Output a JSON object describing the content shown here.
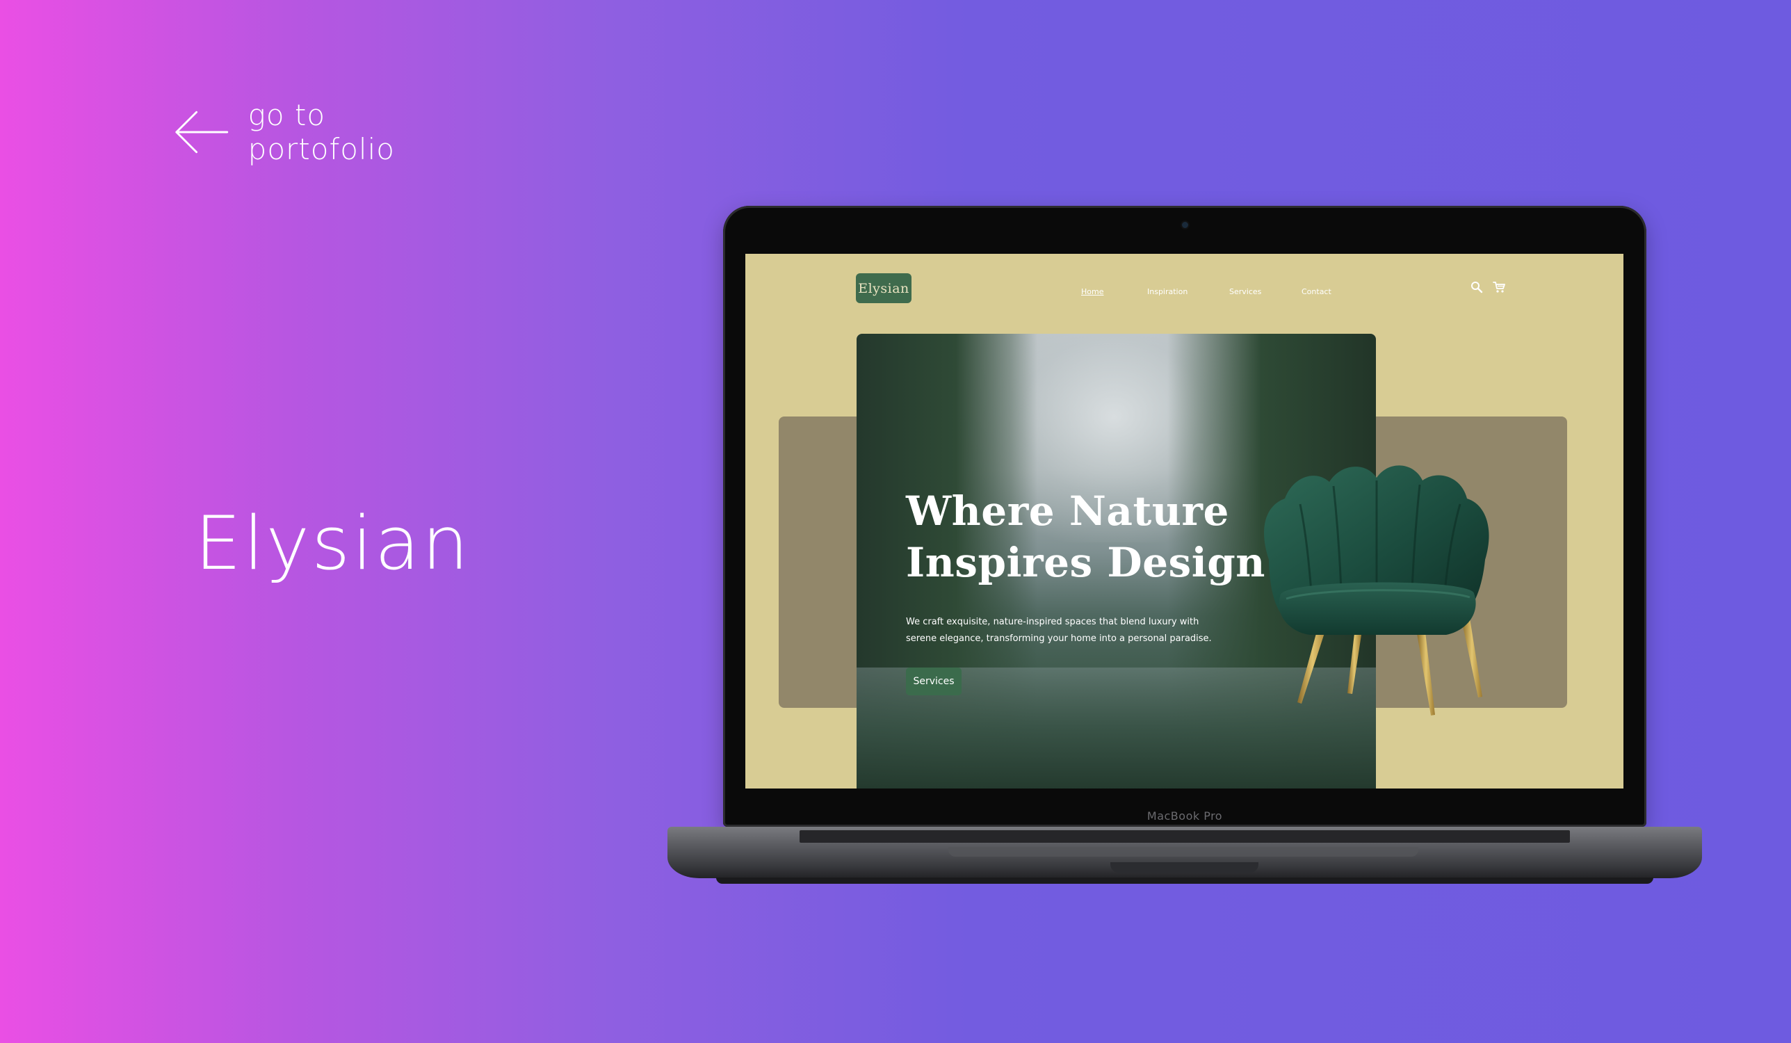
{
  "back_link": {
    "label": "go to portofolio",
    "icon": "arrow-left-icon"
  },
  "project": {
    "title": "Elysian"
  },
  "device": {
    "label": "MacBook Pro"
  },
  "site": {
    "logo": "Elysian",
    "nav": {
      "home": "Home",
      "inspiration": "Inspiration",
      "services": "Services",
      "contact": "Contact",
      "active": "Home"
    },
    "icons": [
      "search-icon",
      "cart-icon"
    ],
    "hero": {
      "title_line1": "Where Nature",
      "title_line2": "Inspires Design",
      "description": "We craft exquisite, nature-inspired spaces that blend luxury with serene elegance, transforming your home into a personal paradise.",
      "cta": "Services",
      "image": "forest-lake-photo",
      "product": "green-velvet-armchair"
    },
    "colors": {
      "page_background": "#d8cc94",
      "backing_panel": "#92876a",
      "brand_green": "#3f6b4d",
      "button_green": "#3b6b4c"
    }
  },
  "colors": {
    "gradient_start": "#ea4fe4",
    "gradient_end": "#6e5be0",
    "text": "#ffffff"
  }
}
